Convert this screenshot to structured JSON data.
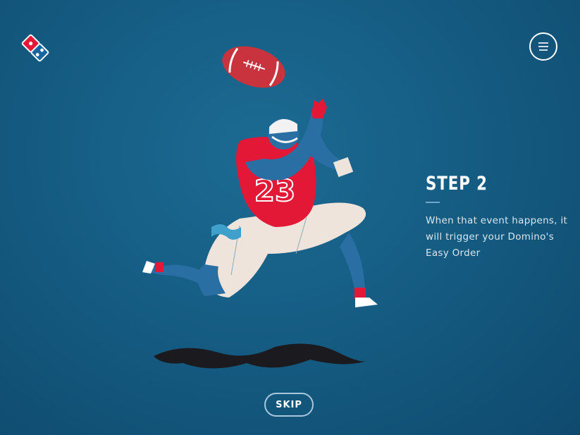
{
  "brand": {
    "logo_icon": "dominos-domino-logo-icon",
    "colors": {
      "blue": "#1565a0",
      "red": "#e31837",
      "background": "#165e85"
    }
  },
  "header": {
    "menu_icon": "hamburger-menu-icon"
  },
  "step": {
    "title": "STEP 2",
    "description": "When that event happens, it will trigger your Domino's Easy Order"
  },
  "illustration": {
    "icon": "football-player-catching-ball-illustration",
    "jersey_number": "23"
  },
  "footer": {
    "skip_label": "SKIP"
  }
}
